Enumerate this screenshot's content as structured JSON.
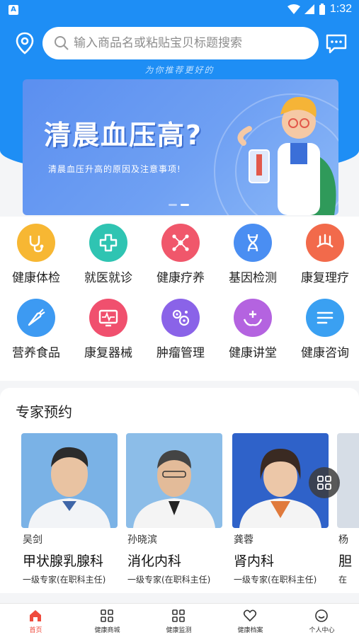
{
  "status_bar": {
    "time": "1:32"
  },
  "search": {
    "placeholder": "输入商品名或粘贴宝贝标题搜索"
  },
  "slogan": "为你推荐更好的",
  "banner": {
    "title": "清晨血压高?",
    "subtitle": "清晨血压升高的原因及注意事项!"
  },
  "grid": [
    {
      "label": "健康体检",
      "icon": "stethoscope-icon",
      "color": "#f7b733"
    },
    {
      "label": "就医就诊",
      "icon": "medical-cross-icon",
      "color": "#2fc4b2"
    },
    {
      "label": "健康疗养",
      "icon": "molecule-icon",
      "color": "#f0576b"
    },
    {
      "label": "基因检测",
      "icon": "dna-icon",
      "color": "#4a8ef2"
    },
    {
      "label": "康复理疗",
      "icon": "therapy-icon",
      "color": "#f26a4b"
    },
    {
      "label": "营养食品",
      "icon": "carrot-icon",
      "color": "#3d9af2"
    },
    {
      "label": "康复器械",
      "icon": "monitor-icon",
      "color": "#f0506e"
    },
    {
      "label": "肿瘤管理",
      "icon": "cells-icon",
      "color": "#8a63e8"
    },
    {
      "label": "健康讲堂",
      "icon": "care-hands-icon",
      "color": "#b463e0"
    },
    {
      "label": "健康咨询",
      "icon": "list-icon",
      "color": "#3aa0f2"
    }
  ],
  "experts": {
    "title": "专家预约",
    "cards": [
      {
        "name": "吴剑",
        "dept": "甲状腺乳腺科",
        "level": "一级专家(在职科主任)"
      },
      {
        "name": "孙晓滨",
        "dept": "消化内科",
        "level": "一级专家(在职科主任)"
      },
      {
        "name": "龚蓉",
        "dept": "肾内科",
        "level": "一级专家(在职科主任)"
      },
      {
        "name": "杨",
        "dept": "胆",
        "level": "在"
      }
    ]
  },
  "nav": [
    {
      "label": "首页",
      "icon": "home-icon",
      "active": true
    },
    {
      "label": "健康商城",
      "icon": "grid-icon",
      "active": false
    },
    {
      "label": "健康监测",
      "icon": "monitor-grid-icon",
      "active": false
    },
    {
      "label": "健康档案",
      "icon": "heart-icon",
      "active": false
    },
    {
      "label": "个人中心",
      "icon": "user-icon",
      "active": false
    }
  ],
  "colors": {
    "primary": "#1e8ef5",
    "nav_active": "#ef4a3c"
  }
}
